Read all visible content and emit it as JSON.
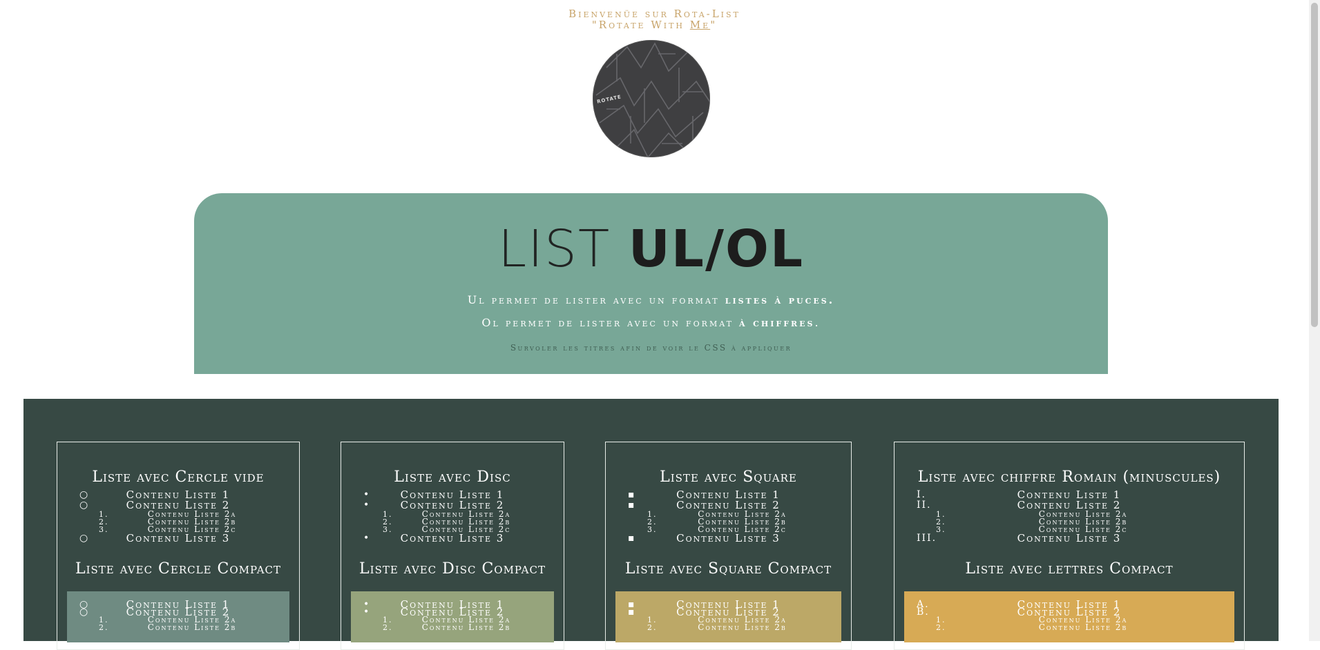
{
  "header": {
    "greeting": "Bienvenüe sur Rota-List",
    "tagline_pre": "\"Rotate With ",
    "tagline_me": "Me",
    "tagline_post": "\"",
    "logo_text": "ROTATE"
  },
  "hero": {
    "title_light": "LIST ",
    "title_bold": "UL/OL",
    "line1_pre": "Ul permet de lister avec un format ",
    "line1_bold": "listes à puces.",
    "line2_pre": "Ol permet de lister avec un format ",
    "line2_bold": "à chiffres",
    "line2_post": ".",
    "hint": "Survoler les titres afin de voir le CSS à appliquer"
  },
  "colors": {
    "hero_bg": "#78a797",
    "stage_bg": "#374944",
    "compact_circle": "#6f8b82",
    "compact_disc": "#96a47c",
    "compact_square": "#bca867",
    "compact_letters": "#d7aa55",
    "accent": "#c8a46a"
  },
  "cards": [
    {
      "title": "Liste avec Cercle vide",
      "markers": [
        "○",
        "○",
        "1.",
        "2.",
        "3.",
        "○"
      ],
      "items": [
        "Contenu Liste 1",
        "Contenu Liste 2",
        "Contenu Liste 2a",
        "Contenu Liste 2b",
        "Contenu Liste 2c",
        "Contenu Liste 3"
      ],
      "compact_title": "Liste avec Cercle Compact",
      "compact_markers": [
        "○",
        "○",
        "1.",
        "2."
      ],
      "compact_items": [
        "Contenu Liste 1",
        "Contenu Liste 2",
        "Contenu Liste 2a",
        "Contenu Liste 2b"
      ]
    },
    {
      "title": "Liste avec Disc",
      "markers": [
        "•",
        "•",
        "1.",
        "2.",
        "3.",
        "•"
      ],
      "items": [
        "Contenu Liste 1",
        "Contenu Liste 2",
        "Contenu Liste 2a",
        "Contenu Liste 2b",
        "Contenu Liste 2c",
        "Contenu Liste 3"
      ],
      "compact_title": "Liste avec Disc Compact",
      "compact_markers": [
        "•",
        "•",
        "1.",
        "2."
      ],
      "compact_items": [
        "Contenu Liste 1",
        "Contenu Liste 2",
        "Contenu Liste 2a",
        "Contenu Liste 2b"
      ]
    },
    {
      "title": "Liste avec Square",
      "markers": [
        "▪",
        "▪",
        "1.",
        "2.",
        "3.",
        "▪"
      ],
      "items": [
        "Contenu Liste 1",
        "Contenu Liste 2",
        "Contenu Liste 2a",
        "Contenu Liste 2b",
        "Contenu Liste 2c",
        "Contenu Liste 3"
      ],
      "compact_title": "Liste avec Square Compact",
      "compact_markers": [
        "▪",
        "▪",
        "1.",
        "2."
      ],
      "compact_items": [
        "Contenu Liste 1",
        "Contenu Liste 2",
        "Contenu Liste 2a",
        "Contenu Liste 2b"
      ]
    },
    {
      "title": "Liste avec chiffre Romain (minuscules)",
      "markers": [
        "I.",
        "II.",
        "1.",
        "2.",
        "3.",
        "III."
      ],
      "items": [
        "Contenu Liste 1",
        "Contenu Liste 2",
        "Contenu Liste 2a",
        "Contenu Liste 2b",
        "Contenu Liste 2c",
        "Contenu Liste 3"
      ],
      "compact_title": "Liste avec lettres Compact",
      "compact_markers": [
        "A.",
        "B.",
        "1.",
        "2."
      ],
      "compact_items": [
        "Contenu Liste 1",
        "Contenu Liste 2",
        "Contenu Liste 2a",
        "Contenu Liste 2b"
      ]
    }
  ]
}
